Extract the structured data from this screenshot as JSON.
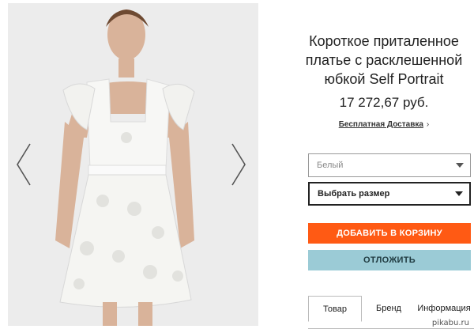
{
  "product": {
    "title": "Короткое приталенное платье с расклешенной юбкой Self Portrait",
    "price": "17 272,67 руб.",
    "delivery_link": "Бесплатная Доставка",
    "delivery_chevron": "›"
  },
  "options": {
    "color_selected": "Белый",
    "size_selected": "Выбрать размер"
  },
  "actions": {
    "add_to_cart": "ДОБАВИТЬ В КОРЗИНУ",
    "save_later": "ОТЛОЖИТЬ"
  },
  "tabs": [
    {
      "label": "Товар"
    },
    {
      "label": "Бренд"
    },
    {
      "label": "Информация"
    }
  ],
  "watermark": "pikabu.ru",
  "colors": {
    "cart_button": "#ff5a14",
    "save_button": "#9bcbd6"
  },
  "icons": {
    "prev": "chevron-left-icon",
    "next": "chevron-right-icon",
    "dropdown": "caret-down-icon"
  }
}
